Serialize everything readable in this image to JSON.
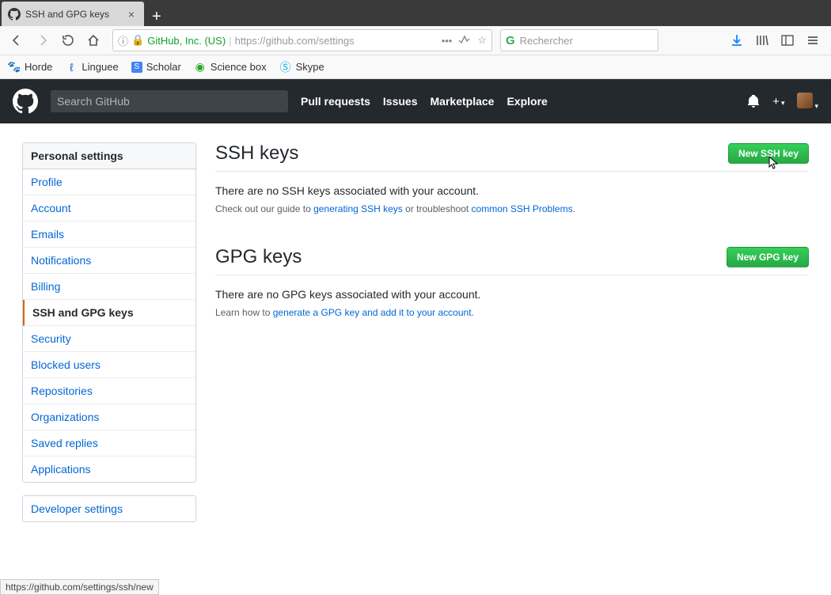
{
  "browser": {
    "tab_title": "SSH and GPG keys",
    "url_identity": "GitHub, Inc. (US)",
    "url_display": "https://github.com/settings",
    "search_placeholder": "Rechercher",
    "bookmarks": [
      {
        "label": "Horde"
      },
      {
        "label": "Linguee"
      },
      {
        "label": "Scholar"
      },
      {
        "label": "Science box"
      },
      {
        "label": "Skype"
      }
    ],
    "status_text": "https://github.com/settings/ssh/new"
  },
  "github": {
    "search_placeholder": "Search GitHub",
    "nav": [
      "Pull requests",
      "Issues",
      "Marketplace",
      "Explore"
    ]
  },
  "sidebar": {
    "header": "Personal settings",
    "items": [
      {
        "label": "Profile"
      },
      {
        "label": "Account"
      },
      {
        "label": "Emails"
      },
      {
        "label": "Notifications"
      },
      {
        "label": "Billing"
      },
      {
        "label": "SSH and GPG keys",
        "active": true
      },
      {
        "label": "Security"
      },
      {
        "label": "Blocked users"
      },
      {
        "label": "Repositories"
      },
      {
        "label": "Organizations"
      },
      {
        "label": "Saved replies"
      },
      {
        "label": "Applications"
      }
    ],
    "developer_header": "Developer settings"
  },
  "sections": {
    "ssh": {
      "title": "SSH keys",
      "button": "New SSH key",
      "empty": "There are no SSH keys associated with your account.",
      "note_pre": "Check out our guide to ",
      "link1": "generating SSH keys",
      "note_mid": " or troubleshoot ",
      "link2": "common SSH Problems",
      "note_post": "."
    },
    "gpg": {
      "title": "GPG keys",
      "button": "New GPG key",
      "empty": "There are no GPG keys associated with your account.",
      "note_pre": "Learn how to ",
      "link1": "generate a GPG key and add it to your account",
      "note_post": "."
    }
  }
}
